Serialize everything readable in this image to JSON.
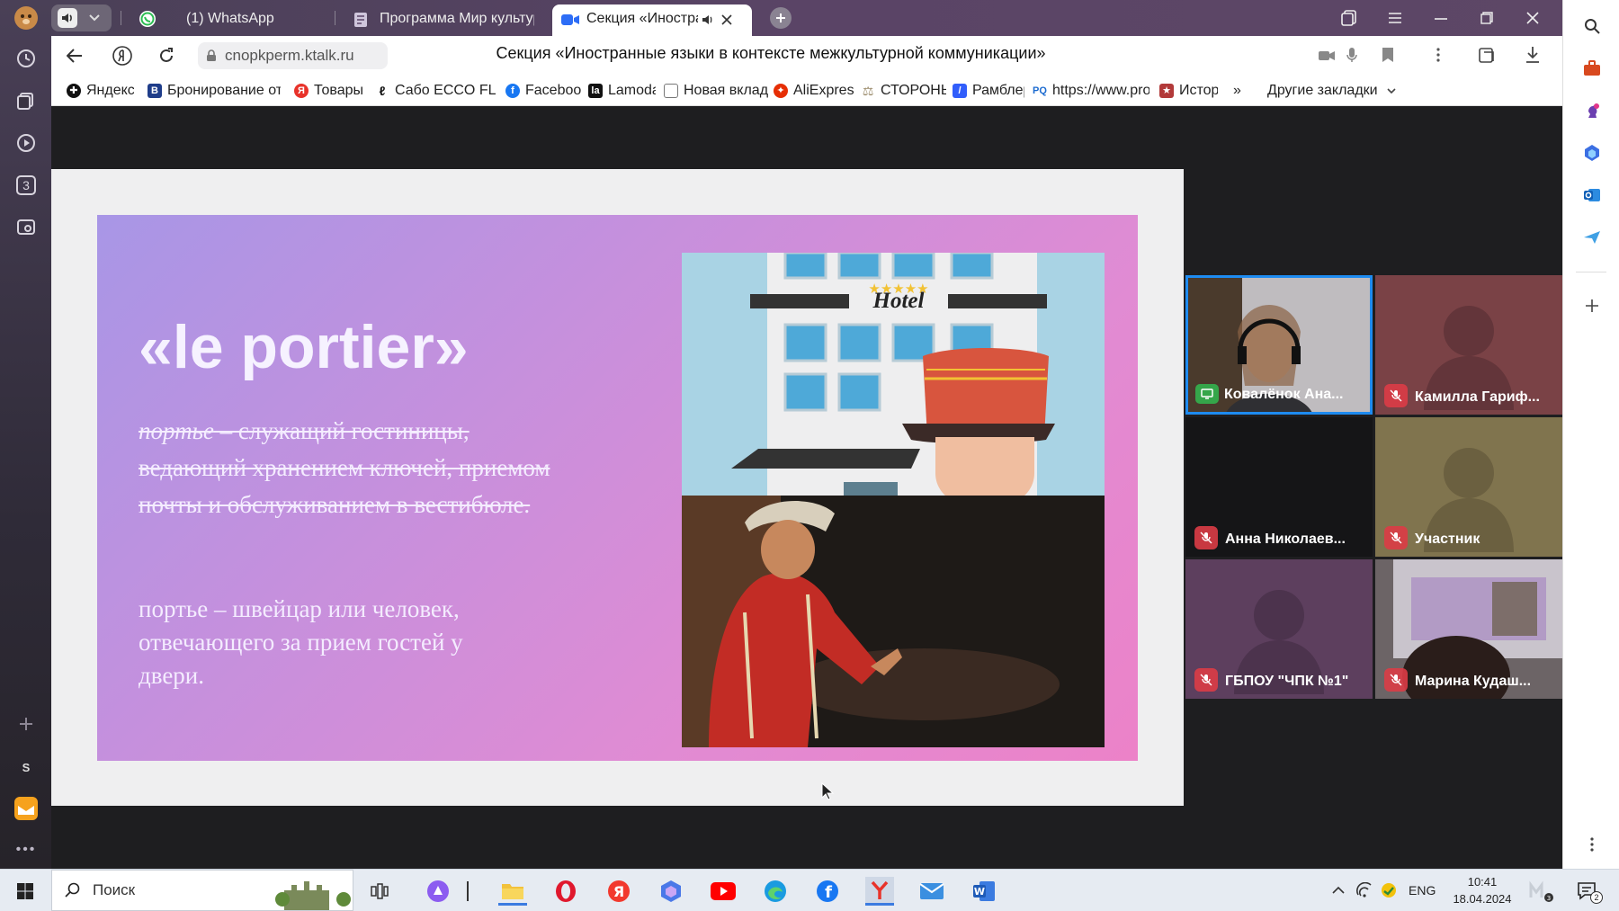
{
  "browser": {
    "tabs": [
      {
        "label": "(1) WhatsApp",
        "icon": "whatsapp-icon"
      },
      {
        "label": "Программа Мир культур",
        "icon": "document-icon"
      },
      {
        "label": "Секция «Иностранн",
        "icon": "video-icon",
        "active": true
      }
    ],
    "address": "cnopkperm.ktalk.ru",
    "page_title": "Секция «Иностранные языки в контексте межкультурной коммуникации»",
    "bookmarks": [
      {
        "label": "Яндекс",
        "icon": "yandex-icon",
        "color": "#111111"
      },
      {
        "label": "Бронирование от",
        "icon": "booking-icon",
        "color": "#1f3d8a"
      },
      {
        "label": "Товары",
        "icon": "yandex-market-icon",
        "color": "#e8322a"
      },
      {
        "label": "Сабо ECCO FLOW",
        "icon": "ecco-icon",
        "color": "#111111"
      },
      {
        "label": "Facebook",
        "icon": "facebook-icon",
        "color": "#1877f2"
      },
      {
        "label": "Lamoda",
        "icon": "lamoda-icon",
        "color": "#111111"
      },
      {
        "label": "Новая вкладка",
        "icon": "page-icon",
        "color": "#777777"
      },
      {
        "label": "AliExpress",
        "icon": "aliexpress-icon",
        "color": "#e62e04"
      },
      {
        "label": "СТОРОНЫ",
        "icon": "scales-icon",
        "color": "#9a8a6a"
      },
      {
        "label": "Рамблер",
        "icon": "rambler-icon",
        "color": "#315efb"
      },
      {
        "label": "https://www.proq",
        "icon": "pq-icon",
        "color": "#1c6bd0"
      },
      {
        "label": "Истори",
        "icon": "history-icon",
        "color": "#b23a3a"
      }
    ],
    "more_bookmarks": "»",
    "other_bookmarks": "Другие закладки"
  },
  "slide": {
    "title": "«le portier»",
    "strike_term": "портье",
    "strike_text": " – служащий гостиницы, ведающий хранением ключей, приемом почты и обслуживанием в вестибюле. ",
    "definition": "портье – швейцар или человек, отвечающего за прием гостей у двери.",
    "hotel_sign": "Hotel"
  },
  "participants": [
    {
      "name": "Ковалёнок Ана...",
      "status": "screen-share",
      "bg": "#3b3838",
      "active": true,
      "video": true
    },
    {
      "name": "Камилла Гариф...",
      "status": "muted",
      "bg": "#7a4246"
    },
    {
      "name": "Анна Николаев...",
      "status": "muted",
      "bg": "#151517"
    },
    {
      "name": "Участник",
      "status": "muted",
      "bg": "#80744e"
    },
    {
      "name": "ГБПОУ \"ЧПК №1\"",
      "status": "muted",
      "bg": "#5d3f5e"
    },
    {
      "name": "Марина Кудаш...",
      "status": "muted",
      "bg": "#504646",
      "video": true
    }
  ],
  "taskbar": {
    "search_placeholder": "Поиск",
    "lang": "ENG",
    "time": "10:41",
    "date": "18.04.2024",
    "notifications": "2"
  },
  "left_sidebar": {
    "badge": "3",
    "s_label": "S"
  }
}
